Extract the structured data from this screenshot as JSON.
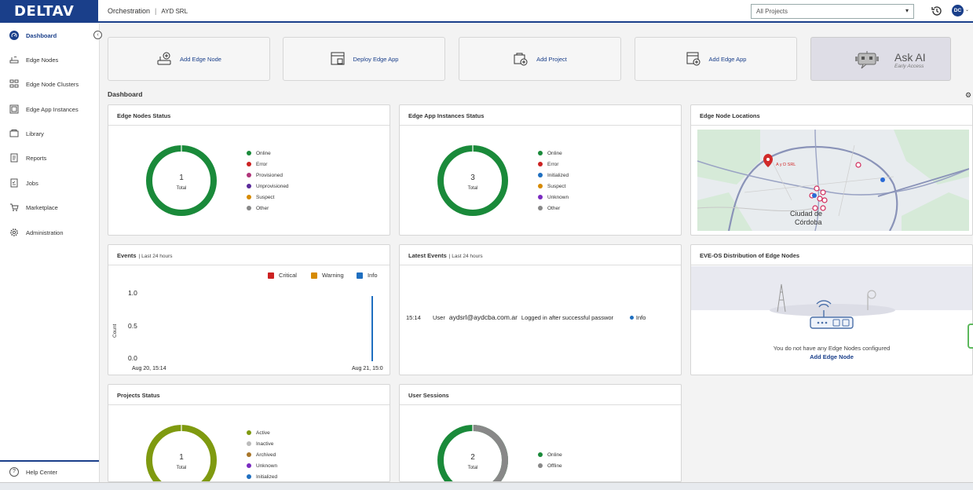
{
  "app": {
    "logo": "DELTAV",
    "section": "Orchestration",
    "org": "AYD SRL"
  },
  "project_select": {
    "value": "All Projects"
  },
  "user": {
    "initials": "DC"
  },
  "sidebar": {
    "items": [
      {
        "label": "Dashboard",
        "icon": "dashboard-icon",
        "active": true
      },
      {
        "label": "Edge Nodes",
        "icon": "edge-node-icon"
      },
      {
        "label": "Edge Node Clusters",
        "icon": "cluster-icon"
      },
      {
        "label": "Edge App Instances",
        "icon": "app-instance-icon"
      },
      {
        "label": "Library",
        "icon": "library-icon"
      },
      {
        "label": "Reports",
        "icon": "reports-icon"
      },
      {
        "label": "Jobs",
        "icon": "jobs-icon"
      },
      {
        "label": "Marketplace",
        "icon": "marketplace-icon"
      },
      {
        "label": "Administration",
        "icon": "gear-icon"
      }
    ],
    "help": "Help Center"
  },
  "actions": [
    {
      "label": "Add Edge Node"
    },
    {
      "label": "Deploy Edge App"
    },
    {
      "label": "Add Project"
    },
    {
      "label": "Add Edge App"
    }
  ],
  "ask_ai": {
    "title": "Ask AI",
    "subtitle": "Early Access"
  },
  "dashboard": {
    "title": "Dashboard"
  },
  "colors": {
    "brand": "#1a3f8a",
    "online": "#1a8a3a",
    "project_active": "#7f9a10",
    "offline": "#888888"
  },
  "panels": {
    "edge_nodes_status": {
      "title": "Edge Nodes Status",
      "total": "1",
      "total_label": "Total",
      "legend": [
        "Online",
        "Error",
        "Provisioned",
        "Unprovisioned",
        "Suspect",
        "Other"
      ]
    },
    "edge_app_status": {
      "title": "Edge App Instances Status",
      "total": "3",
      "total_label": "Total",
      "legend": [
        "Online",
        "Error",
        "Initialized",
        "Suspect",
        "Unknown",
        "Other"
      ]
    },
    "locations": {
      "title": "Edge Node Locations",
      "marker_label": "A y D SRL",
      "city_line1": "Ciudad de",
      "city_line2": "Córdoba"
    },
    "events": {
      "title": "Events",
      "sub": "Last 24 hours",
      "legend": [
        "Critical",
        "Warning",
        "Info"
      ],
      "ylabel": "Count",
      "yticks": [
        "1.0",
        "0.5",
        "0.0"
      ],
      "xticks": [
        "Aug 20, 15:14",
        "Aug 21, 15:0"
      ]
    },
    "latest_events": {
      "title": "Latest Events",
      "sub": "Last 24 hours",
      "rows": [
        {
          "time": "15:14",
          "user_label": "User",
          "email": "aydsrl@aydcba.com.ar",
          "message": "Logged in after successful passwor",
          "severity": "Info"
        }
      ]
    },
    "eve_os": {
      "title": "EVE-OS Distribution of Edge Nodes",
      "empty_text": "You do not have any Edge Nodes configured",
      "link": "Add Edge Node"
    },
    "projects_status": {
      "title": "Projects Status",
      "total": "1",
      "total_label": "Total",
      "legend": [
        "Active",
        "Inactive",
        "Archived",
        "Unknown",
        "Initialized"
      ]
    },
    "user_sessions": {
      "title": "User Sessions",
      "total": "2",
      "total_label": "Total",
      "legend": [
        "Online",
        "Offline"
      ]
    }
  }
}
